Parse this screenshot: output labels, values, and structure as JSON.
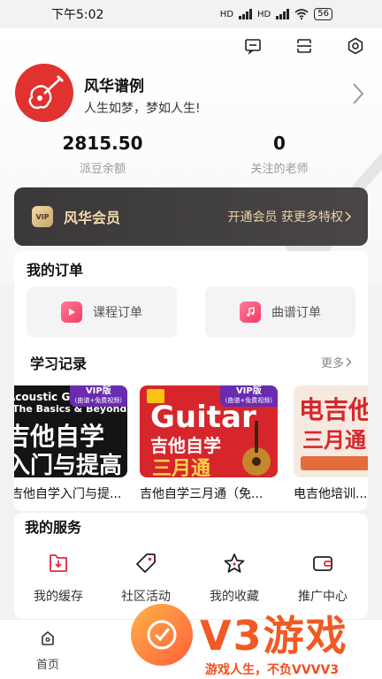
{
  "status_bar": {
    "time": "下午5:02",
    "signal1": "HD",
    "signal2": "HD",
    "battery": "56"
  },
  "header": {
    "actions": [
      "message-icon",
      "scan-icon",
      "settings-icon"
    ]
  },
  "profile": {
    "name": "风华谱例",
    "motto": "人生如梦，梦如人生!",
    "balance_value": "2815.50",
    "balance_label": "派豆余额",
    "teachers_value": "0",
    "teachers_label": "关注的老师"
  },
  "vip": {
    "badge": "VIP",
    "title": "风华会员",
    "cta": "开通会员 获更多特权"
  },
  "orders": {
    "title": "我的订单",
    "course": "课程订单",
    "sheet": "曲谱订单"
  },
  "history": {
    "title": "学习记录",
    "more": "更多",
    "items": [
      {
        "title": "吉他自学入门与提...",
        "cover_line1": "Acoustic Guitar",
        "cover_line2": "The Basics & Beyond",
        "cover_line3": "吉他自学",
        "cover_line4": "入门与提高",
        "vip_tag": "VIP版",
        "vip_sub": "(曲谱+免费视频)"
      },
      {
        "title": "吉他自学三月通（免...",
        "cover_line1": "Guitar",
        "cover_line2": "吉他自学",
        "cover_line3": "三月通",
        "vip_tag": "VIP版",
        "vip_sub": "(曲谱+免费视频)"
      },
      {
        "title": "电吉他培训...",
        "cover_line1": "电吉他",
        "cover_line2": "三月通"
      }
    ]
  },
  "services": {
    "title": "我的服务",
    "items": [
      {
        "label": "我的缓存",
        "icon": "download-icon"
      },
      {
        "label": "社区活动",
        "icon": "tag-icon"
      },
      {
        "label": "我的收藏",
        "icon": "star-icon"
      },
      {
        "label": "推广中心",
        "icon": "wallet-icon"
      }
    ]
  },
  "tab_bar": {
    "home": "首页"
  },
  "watermark": {
    "brand": "V3游戏",
    "slogan": "游戏人生，不负VVVV3"
  },
  "colors": {
    "accent": "#e0322e",
    "vip_gold": "#f1d9ad",
    "vip_bg": "#3a3838",
    "order_pink": "#f23a62"
  }
}
